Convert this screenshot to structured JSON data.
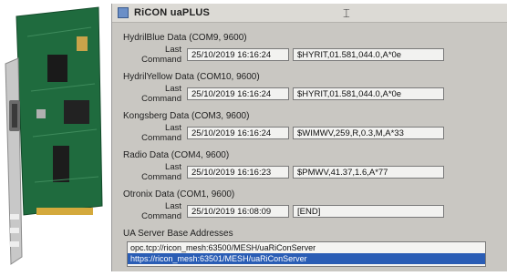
{
  "app": {
    "title": "RiCON uaPLUS"
  },
  "row_label": "Last Command",
  "groups": [
    {
      "title": "HydrilBlue Data (COM9, 9600)",
      "date": "25/10/2019 16:16:24",
      "cmd": "$HYRIT,01.581,044.0,A*0e"
    },
    {
      "title": "HydrilYellow Data (COM10, 9600)",
      "date": "25/10/2019 16:16:24",
      "cmd": "$HYRIT,01.581,044.0,A*0e"
    },
    {
      "title": "Kongsberg Data (COM3, 9600)",
      "date": "25/10/2019 16:16:24",
      "cmd": "$WIMWV,259,R,0.3,M,A*33"
    },
    {
      "title": "Radio Data (COM4, 9600)",
      "date": "25/10/2019 16:16:23",
      "cmd": "$PMWV,41.37,1.6,A*77"
    },
    {
      "title": "Otronix Data (COM1, 9600)",
      "date": "25/10/2019 16:08:09",
      "cmd": "[END]"
    }
  ],
  "server": {
    "title": "UA Server Base Addresses",
    "addresses": [
      "opc.tcp://ricon_mesh:63500/MESH/uaRiConServer",
      "https://ricon_mesh:63501/MESH/uaRiConServer"
    ]
  },
  "colors": {
    "window_bg": "#c9c7c2",
    "selection": "#2a5db5",
    "pcb": "#1f6b3e",
    "bracket": "#c8c8c8"
  },
  "icons": [
    "app-icon",
    "cursor-icon",
    "pci-card-image"
  ]
}
